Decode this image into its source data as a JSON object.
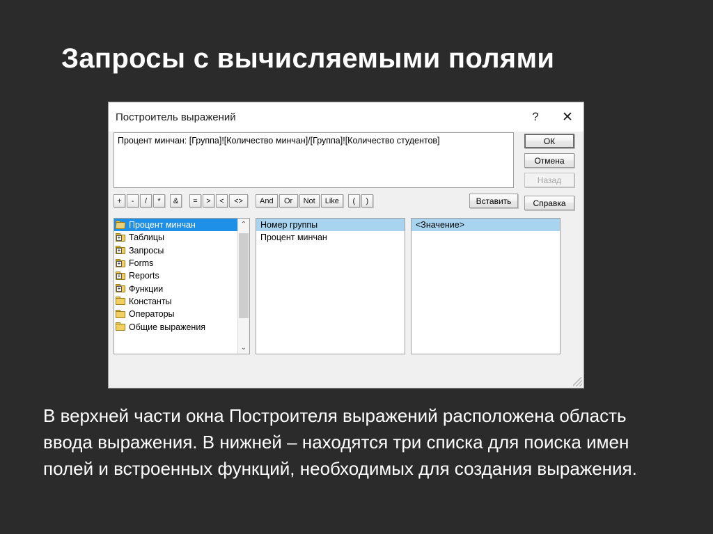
{
  "slide": {
    "title": "Запросы с вычисляемыми полями",
    "paragraph": "В верхней части окна Построителя выражений расположена область ввода выражения. В нижней – находятся три списка для поиска имен полей и встроенных функций, необходимых для создания выражения.",
    "background_color": "#2b2b2b",
    "text_color": "#ffffff"
  },
  "dialog": {
    "title": "Построитель выражений",
    "help_button": "?",
    "close_button": "✕",
    "expression": "Процент минчан: [Группа]![Количество минчан]/[Группа]![Количество студентов]",
    "expression_placeholder": "",
    "buttons": {
      "ok": "ОК",
      "cancel": "Отмена",
      "back": "Назад",
      "back_disabled": true,
      "insert": "Вставить",
      "help": "Справка"
    },
    "operators": [
      {
        "label": "+",
        "wide": false
      },
      {
        "label": "-",
        "wide": false
      },
      {
        "label": "/",
        "wide": false
      },
      {
        "label": "*",
        "wide": false
      },
      {
        "label": "&",
        "wide": false
      },
      {
        "label": "=",
        "wide": false
      },
      {
        "label": ">",
        "wide": false
      },
      {
        "label": "<",
        "wide": false
      },
      {
        "label": "<>",
        "wide": true
      },
      {
        "label": "And",
        "wide": true
      },
      {
        "label": "Or",
        "wide": true
      },
      {
        "label": "Not",
        "wide": true
      },
      {
        "label": "Like",
        "wide": true
      },
      {
        "label": "(",
        "wide": false
      },
      {
        "label": ")",
        "wide": false
      }
    ],
    "panes": {
      "left": {
        "items": [
          {
            "label": "Процент минчан",
            "icon": "folder-open-icon",
            "selected": true,
            "expandable": false
          },
          {
            "label": "Таблицы",
            "icon": "folder-expand-icon",
            "selected": false,
            "expandable": true
          },
          {
            "label": "Запросы",
            "icon": "folder-expand-icon",
            "selected": false,
            "expandable": true
          },
          {
            "label": "Forms",
            "icon": "folder-expand-icon",
            "selected": false,
            "expandable": true
          },
          {
            "label": "Reports",
            "icon": "folder-expand-icon",
            "selected": false,
            "expandable": true
          },
          {
            "label": "Функции",
            "icon": "folder-expand-icon",
            "selected": false,
            "expandable": true
          },
          {
            "label": "Константы",
            "icon": "folder-icon",
            "selected": false,
            "expandable": false
          },
          {
            "label": "Операторы",
            "icon": "folder-icon",
            "selected": false,
            "expandable": false
          },
          {
            "label": "Общие выражения",
            "icon": "folder-icon",
            "selected": false,
            "expandable": false
          }
        ],
        "scrollbar": {
          "up_arrow": "⌃",
          "down_arrow": "⌄"
        }
      },
      "middle": {
        "items": [
          {
            "label": "Номер группы",
            "selected": true
          },
          {
            "label": "Процент минчан",
            "selected": false
          }
        ]
      },
      "right": {
        "items": [
          {
            "label": "<Значение>",
            "selected": true
          }
        ]
      }
    },
    "colors": {
      "selection_active": "#1e90e8",
      "selection_inactive": "#a8d4f0",
      "dialog_face": "#f0f0f0",
      "field_background": "#ffffff",
      "folder_yellow": "#f2cf63"
    }
  }
}
